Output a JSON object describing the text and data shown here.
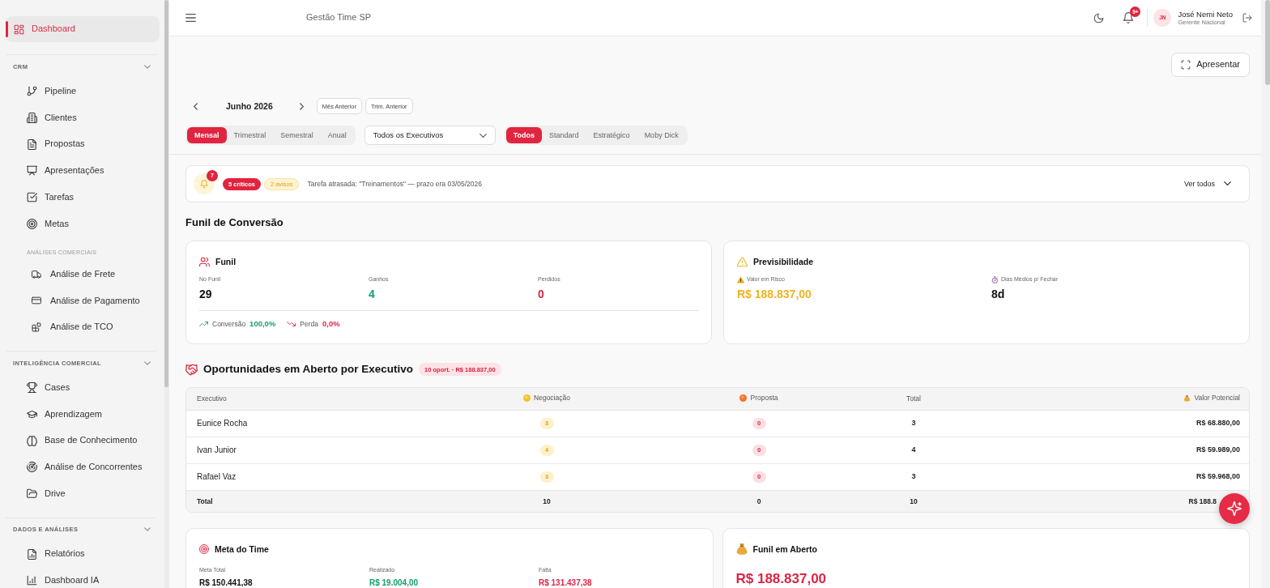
{
  "sidebar": {
    "items": [
      {
        "label": "Dashboard",
        "selected": true
      }
    ],
    "sections": [
      {
        "title": "CRM",
        "expanded": true,
        "items": [
          {
            "label": "Pipeline",
            "selected": false
          },
          {
            "label": "Clientes",
            "selected": false
          },
          {
            "label": "Propostas",
            "selected": false
          },
          {
            "label": "Apresentações",
            "selected": false
          },
          {
            "label": "Tarefas",
            "selected": false
          },
          {
            "label": "Metas",
            "selected": false
          }
        ],
        "subsections": [
          {
            "title": "ANÁLISES COMERCIAIS",
            "items": [
              {
                "label": "Análise de Frete",
                "selected": false
              },
              {
                "label": "Análise de Pagamento",
                "selected": false
              },
              {
                "label": "Análise de TCO",
                "selected": false
              }
            ]
          }
        ]
      },
      {
        "title": "INTELIGÊNCIA COMERCIAL",
        "expanded": true,
        "items": [
          {
            "label": "Cases",
            "selected": false
          },
          {
            "label": "Aprendizagem",
            "selected": false
          },
          {
            "label": "Base de Conhecimento",
            "selected": false
          },
          {
            "label": "Análise de Concorrentes",
            "selected": false
          },
          {
            "label": "Drive",
            "selected": false
          }
        ]
      },
      {
        "title": "DADOS E ANÁLISES",
        "expanded": true,
        "items": [
          {
            "label": "Relatórios",
            "selected": false
          },
          {
            "label": "Dashboard IA",
            "selected": false
          }
        ]
      }
    ]
  },
  "header": {
    "title": "Gestão Time SP",
    "notification_count": "9+",
    "user": {
      "initials": "JN",
      "name": "José Nemi Neto",
      "role": "Gerente Nacional"
    }
  },
  "present_button": "Apresentar",
  "period": {
    "label": "Junho 2026",
    "shortcuts": [
      "Mês Anterior",
      "Trim. Anterior"
    ]
  },
  "filters": {
    "ranges": [
      {
        "label": "Mensal",
        "selected": true
      },
      {
        "label": "Trimestral",
        "selected": false
      },
      {
        "label": "Semestral",
        "selected": false
      },
      {
        "label": "Anual",
        "selected": false
      }
    ],
    "executive": "Todos os Executivos",
    "segments": [
      {
        "label": "Todos",
        "selected": true
      },
      {
        "label": "Standard",
        "selected": false
      },
      {
        "label": "Estratégico",
        "selected": false
      },
      {
        "label": "Moby Dick",
        "selected": false
      }
    ]
  },
  "alerts": {
    "count": "7",
    "tags": [
      {
        "label": "5 críticos",
        "kind": "critical"
      },
      {
        "label": "2 avisos",
        "kind": "warning"
      }
    ],
    "message": "Tarefa atrasada: \"Treinamentos\" — prazo era 03/05/2026",
    "view_all": "Ver todos"
  },
  "conversion": {
    "title": "Funil de Conversão",
    "funnel": {
      "title": "Funil",
      "stats": [
        {
          "label": "No Funil",
          "value": "29",
          "kind": "neutral"
        },
        {
          "label": "Ganhos",
          "value": "4",
          "kind": "positive"
        },
        {
          "label": "Perdidos",
          "value": "0",
          "kind": "negative"
        }
      ],
      "rates": [
        {
          "label": "Conversão",
          "value": "100,0%",
          "kind": "up"
        },
        {
          "label": "Perda",
          "value": "0,0%",
          "kind": "down"
        }
      ]
    },
    "predictability": {
      "title": "Previsibilidade",
      "stats": [
        {
          "label": "Valor em Risco",
          "value": "R$ 188.837,00",
          "kind": "risk"
        },
        {
          "label": "Dias Médios p/ Fechar",
          "value": "8d",
          "kind": "duration"
        }
      ]
    }
  },
  "opportunities": {
    "title": "Oportunidades em Aberto por Executivo",
    "summary": "10 oport. · R$ 188.837,00",
    "table": {
      "columns": [
        {
          "label": "Executivo",
          "kind": "name"
        },
        {
          "label": "Negociação",
          "kind": "negotiation"
        },
        {
          "label": "Proposta",
          "kind": "proposal"
        },
        {
          "label": "Total",
          "kind": "total"
        },
        {
          "label": "Valor Potencial",
          "kind": "value"
        }
      ],
      "rows": [
        [
          "Eunice Rocha",
          "3",
          "0",
          "3",
          "R$ 68.880,00"
        ],
        [
          "Ivan Junior",
          "4",
          "0",
          "4",
          "R$ 59.989,00"
        ],
        [
          "Rafael Vaz",
          "3",
          "0",
          "3",
          "R$ 59.968,00"
        ]
      ],
      "total_row": [
        "Total",
        "10",
        "0",
        "10",
        "R$ 188.8"
      ]
    }
  },
  "team_goal": {
    "title": "Meta do Time",
    "stats": [
      {
        "label": "Meta Total",
        "value": "R$ 150.441,38",
        "kind": "neutral"
      },
      {
        "label": "Realizado",
        "value": "R$ 19.004,00",
        "kind": "positive"
      },
      {
        "label": "Falta",
        "value": "R$ 131.437,38",
        "kind": "negative"
      }
    ]
  },
  "open_funnel": {
    "title": "Funil em Aberto",
    "value": "R$ 188.837,00"
  }
}
